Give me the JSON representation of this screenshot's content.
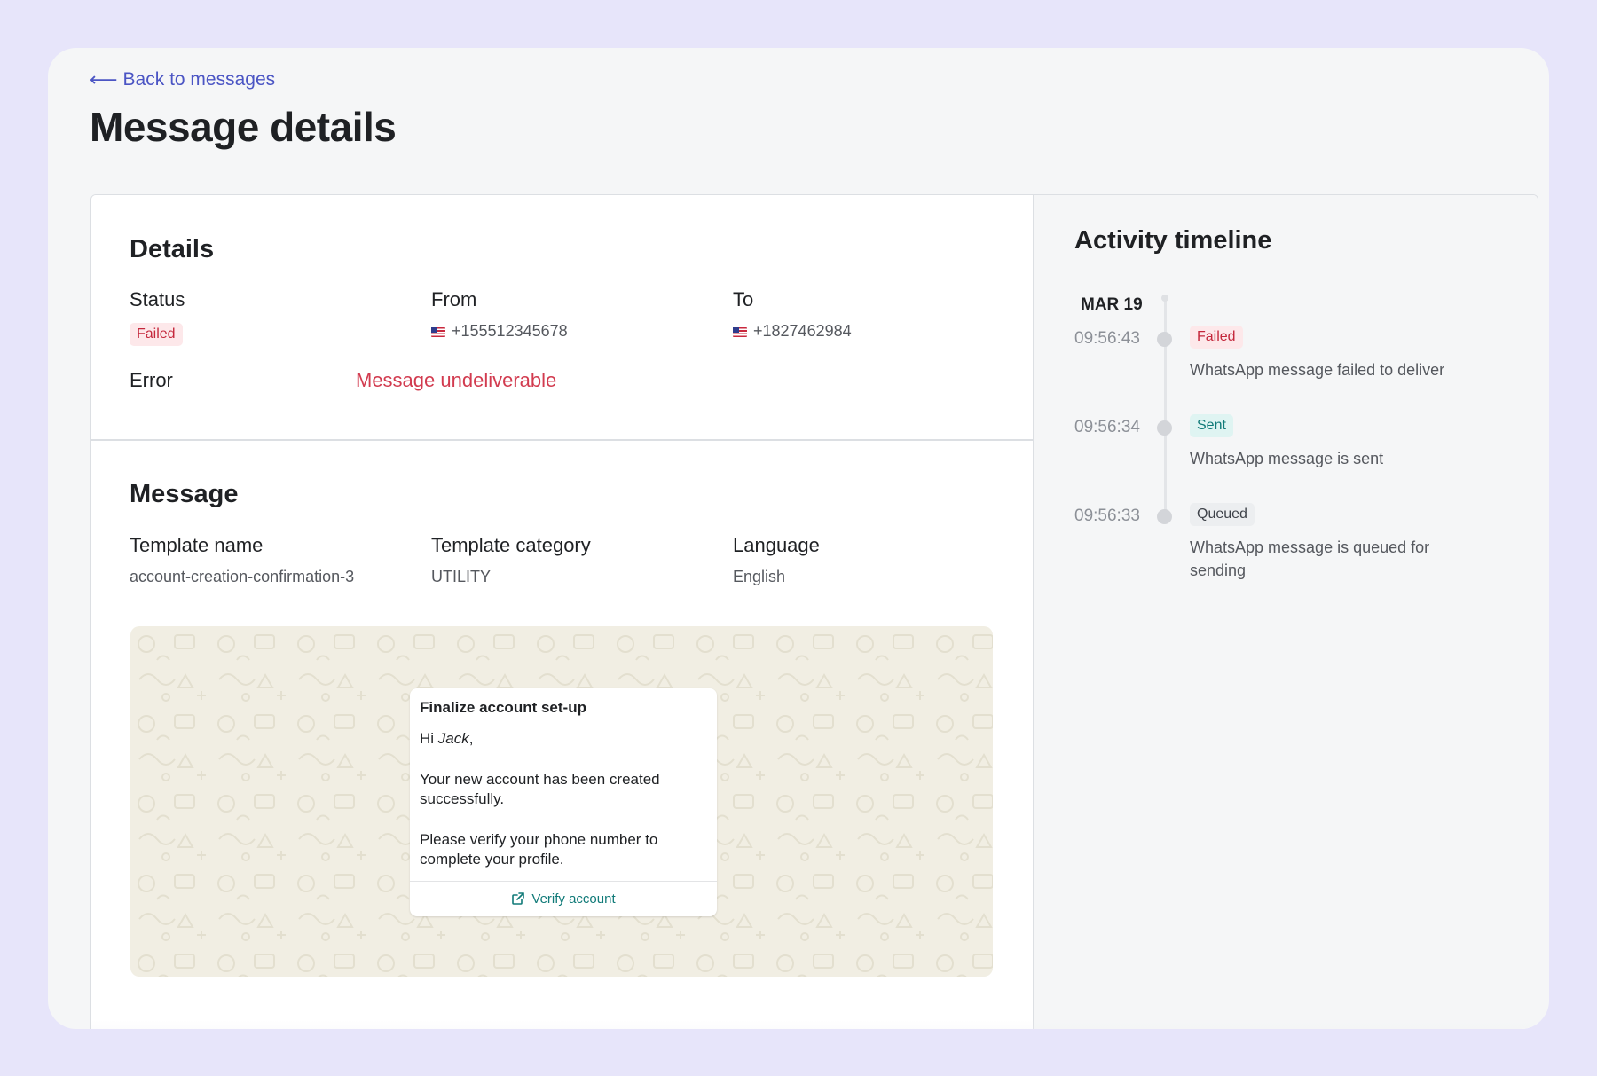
{
  "nav": {
    "back_label": "Back to messages"
  },
  "page": {
    "title": "Message details"
  },
  "details": {
    "heading": "Details",
    "status_label": "Status",
    "status_value": "Failed",
    "from_label": "From",
    "from_value": "+155512345678",
    "to_label": "To",
    "to_value": "+1827462984",
    "error_label": "Error",
    "error_value": "Message undeliverable"
  },
  "message": {
    "heading": "Message",
    "template_name_label": "Template name",
    "template_name_value": "account-creation-confirmation-3",
    "template_category_label": "Template category",
    "template_category_value": "UTILITY",
    "language_label": "Language",
    "language_value": "English",
    "preview": {
      "title": "Finalize account set-up",
      "greeting": "Hi",
      "name": "Jack",
      "greeting_punct": ",",
      "paragraph1": "Your new account has been created successfully.",
      "paragraph2": "Please verify your phone number to complete your profile.",
      "action_label": "Verify account"
    }
  },
  "timeline": {
    "heading": "Activity timeline",
    "date": "MAR 19",
    "events": [
      {
        "time": "09:56:43",
        "status": "Failed",
        "description": "WhatsApp message failed to deliver"
      },
      {
        "time": "09:56:34",
        "status": "Sent",
        "description": "WhatsApp message is sent"
      },
      {
        "time": "09:56:33",
        "status": "Queued",
        "description": "WhatsApp message is queued for sending"
      }
    ]
  },
  "colors": {
    "accent": "#4b55c4",
    "failed": "#c4273b",
    "sent": "#107a78",
    "error_text": "#d23b4f",
    "chat_background": "#f1eee3"
  }
}
